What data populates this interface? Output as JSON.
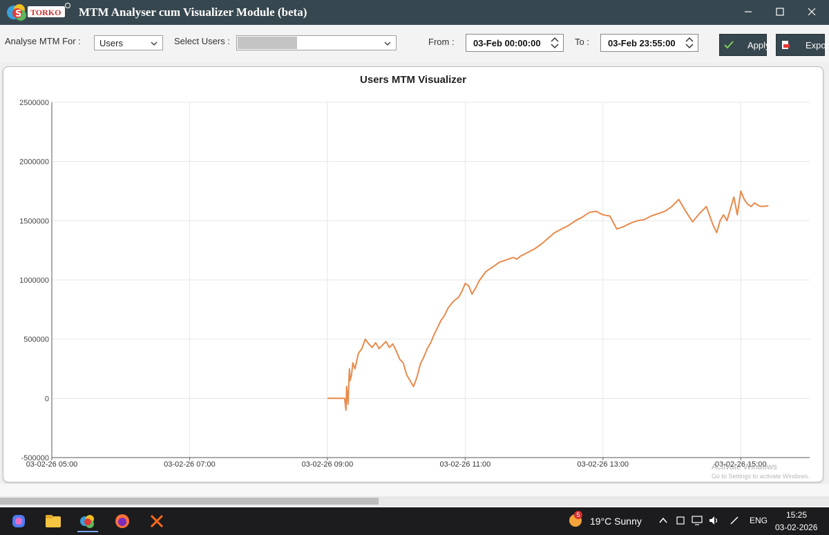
{
  "window": {
    "title": "MTM Analyser cum Visualizer Module (beta)",
    "logo_text": "TORKO"
  },
  "toolbar": {
    "analyse_label": "Analyse MTM For :",
    "analyse_value": "Users",
    "select_users_label": "Select Users :",
    "from_label": "From :",
    "from_value": "03-Feb 00:00:00",
    "to_label": "To :",
    "to_value": "03-Feb 23:55:00",
    "apply_label": "Apply",
    "export_label": "Export"
  },
  "chart_data": {
    "type": "line",
    "title": "Users MTM Visualizer",
    "xlabel": "",
    "ylabel": "",
    "x_ticks": [
      "03-02-26 05:00",
      "03-02-26 07:00",
      "03-02-26 09:00",
      "03-02-26 11:00",
      "03-02-26 13:00",
      "03-02-26 15:00"
    ],
    "x_range_hours": [
      5.0,
      16.0
    ],
    "ylim": [
      -500000,
      2500000
    ],
    "y_ticks": [
      -500000,
      0,
      500000,
      1000000,
      1500000,
      2000000,
      2500000
    ],
    "grid": true,
    "series": [
      {
        "color": "#e8894a",
        "x_hours": [
          9.0,
          9.25,
          9.27,
          9.28,
          9.3,
          9.32,
          9.33,
          9.35,
          9.37,
          9.4,
          9.45,
          9.5,
          9.55,
          9.6,
          9.65,
          9.7,
          9.75,
          9.8,
          9.85,
          9.9,
          9.95,
          10.0,
          10.05,
          10.1,
          10.15,
          10.2,
          10.25,
          10.3,
          10.35,
          10.4,
          10.45,
          10.5,
          10.55,
          10.6,
          10.65,
          10.7,
          10.75,
          10.8,
          10.85,
          10.9,
          10.95,
          11.0,
          11.05,
          11.1,
          11.15,
          11.2,
          11.25,
          11.3,
          11.35,
          11.4,
          11.45,
          11.5,
          11.55,
          11.6,
          11.65,
          11.7,
          11.75,
          11.8,
          11.9,
          12.0,
          12.1,
          12.2,
          12.3,
          12.4,
          12.5,
          12.6,
          12.7,
          12.8,
          12.9,
          13.0,
          13.1,
          13.2,
          13.3,
          13.4,
          13.5,
          13.6,
          13.7,
          13.8,
          13.9,
          14.0,
          14.1,
          14.2,
          14.3,
          14.4,
          14.5,
          14.6,
          14.65,
          14.7,
          14.75,
          14.8,
          14.85,
          14.9,
          14.95,
          15.0,
          15.05,
          15.1,
          15.15,
          15.2,
          15.25,
          15.3,
          15.4
        ],
        "values": [
          0,
          0,
          -100000,
          100000,
          -50000,
          250000,
          150000,
          200000,
          300000,
          250000,
          380000,
          420000,
          500000,
          460000,
          430000,
          470000,
          420000,
          450000,
          480000,
          430000,
          460000,
          400000,
          330000,
          300000,
          200000,
          150000,
          100000,
          180000,
          290000,
          350000,
          420000,
          470000,
          540000,
          600000,
          660000,
          700000,
          760000,
          800000,
          830000,
          850000,
          900000,
          970000,
          950000,
          880000,
          930000,
          990000,
          1030000,
          1070000,
          1090000,
          1110000,
          1130000,
          1150000,
          1160000,
          1170000,
          1180000,
          1190000,
          1175000,
          1200000,
          1230000,
          1260000,
          1300000,
          1350000,
          1400000,
          1430000,
          1460000,
          1500000,
          1530000,
          1570000,
          1580000,
          1550000,
          1540000,
          1430000,
          1450000,
          1480000,
          1500000,
          1510000,
          1540000,
          1560000,
          1580000,
          1620000,
          1680000,
          1580000,
          1490000,
          1560000,
          1620000,
          1460000,
          1400000,
          1500000,
          1550000,
          1500000,
          1600000,
          1700000,
          1550000,
          1750000,
          1680000,
          1640000,
          1620000,
          1650000,
          1630000,
          1620000,
          1625000
        ]
      }
    ]
  },
  "watermark": {
    "line1": "Activate Windows",
    "line2": "Go to Settings to activate Windows."
  },
  "taskbar": {
    "weather": "19°C  Sunny",
    "weather_badge": "5",
    "lang": "ENG",
    "time": "15:25",
    "date": "03-02-2026"
  }
}
